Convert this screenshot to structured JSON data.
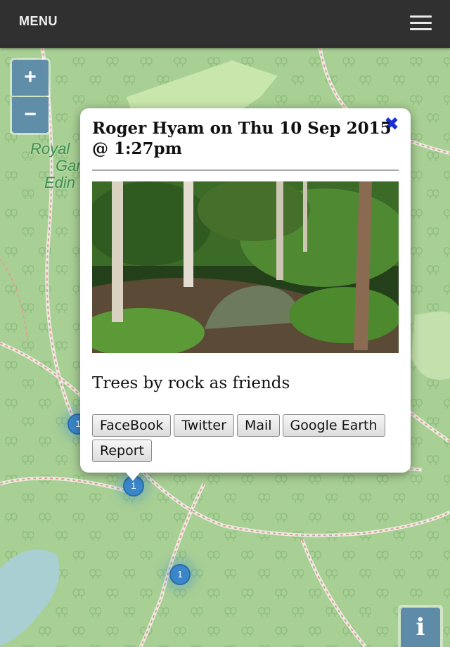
{
  "header": {
    "menu_label": "MENU",
    "menu_icon": "hamburger-icon"
  },
  "map": {
    "zoom_in_label": "+",
    "zoom_out_label": "−",
    "info_label": "i",
    "garden_label_lines": [
      "Royal",
      "Gar",
      "Edin"
    ],
    "clusters": [
      {
        "count": "1"
      },
      {
        "count": "1"
      },
      {
        "count": "1"
      }
    ]
  },
  "popup": {
    "title": "Roger Hyam on Thu 10 Sep 2015 @ 1:27pm",
    "close_label": "✖",
    "caption": "Trees by rock as friends",
    "buttons": [
      "FaceBook",
      "Twitter",
      "Mail",
      "Google Earth",
      "Report"
    ]
  },
  "colors": {
    "map_green": "#a8cf94",
    "path": "#e8a1a1",
    "cluster": "#3a86c8",
    "control": "#5786a5",
    "close": "#1a2fd6"
  }
}
